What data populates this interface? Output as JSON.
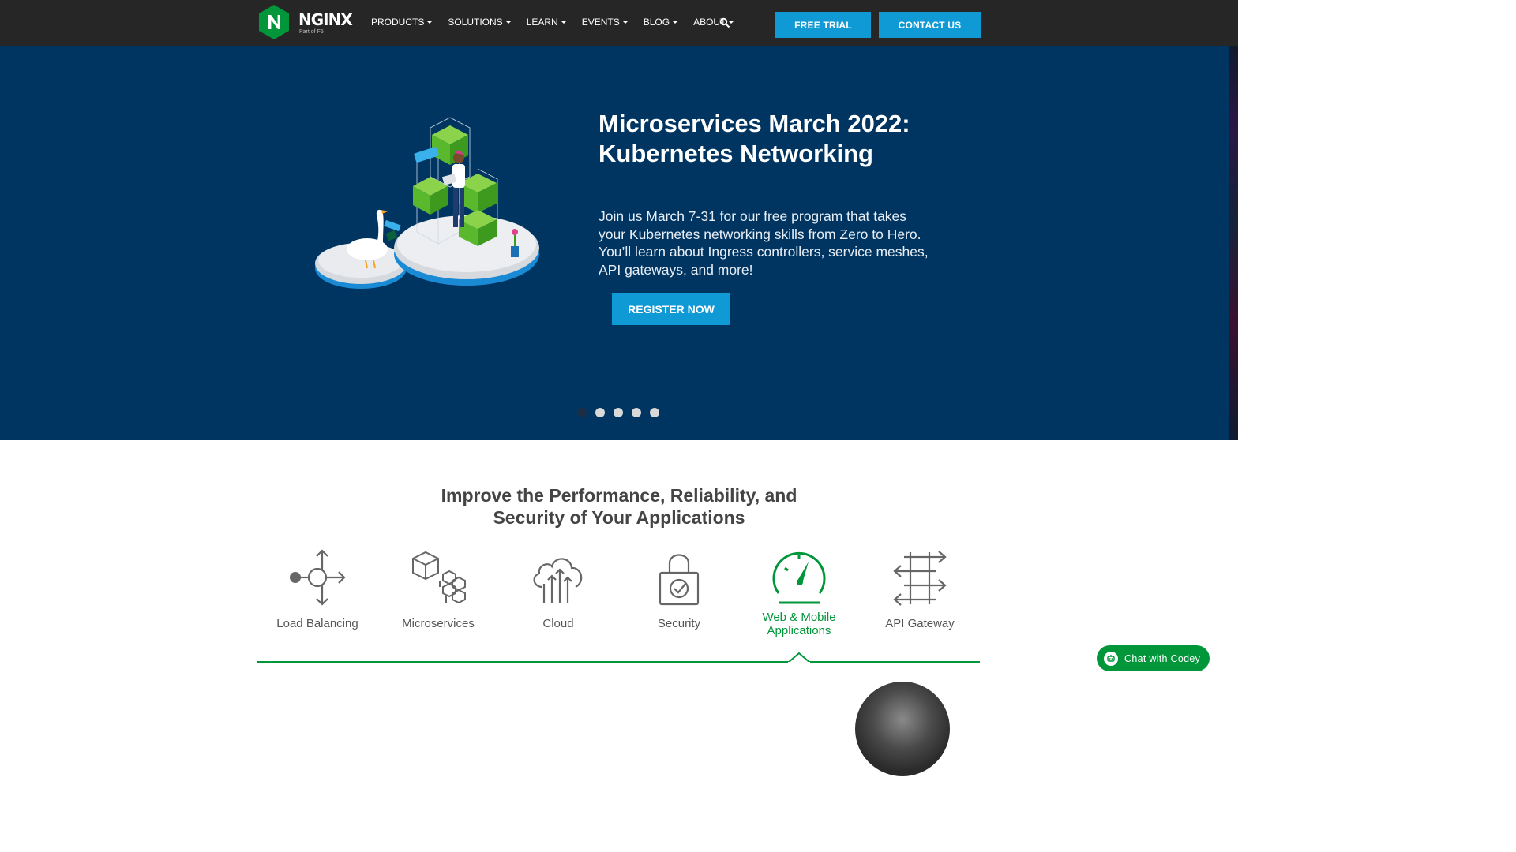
{
  "brand": {
    "name": "NGINX",
    "tagline": "Part of F5",
    "logo_letter": "N",
    "color_green": "#009639"
  },
  "nav": {
    "items": [
      {
        "label": "PRODUCTS",
        "has_dropdown": true
      },
      {
        "label": "SOLUTIONS",
        "has_dropdown": true
      },
      {
        "label": "LEARN",
        "has_dropdown": true
      },
      {
        "label": "EVENTS",
        "has_dropdown": true
      },
      {
        "label": "BLOG",
        "has_dropdown": true
      },
      {
        "label": "ABOUT",
        "has_dropdown": true
      }
    ],
    "search_icon": "search-icon",
    "free_trial": "FREE TRIAL",
    "contact_us": "CONTACT US"
  },
  "hero": {
    "title": "Microservices March 2022: Kubernetes Networking",
    "description": "Join us March 7-31 for our free program that takes your Kubernetes networking skills from Zero to Hero. You’ll learn about Ingress controllers, service meshes, API gateways, and more!",
    "cta": "REGISTER NOW",
    "background": "#003562",
    "slides_total": 5,
    "active_slide": 1
  },
  "improve": {
    "title": "Improve the Performance, Reliability, and Security of Your Applications",
    "features": [
      {
        "label": "Load Balancing",
        "icon": "load-balancing-icon",
        "active": false
      },
      {
        "label": "Microservices",
        "icon": "microservices-icon",
        "active": false
      },
      {
        "label": "Cloud",
        "icon": "cloud-icon",
        "active": false
      },
      {
        "label": "Security",
        "icon": "security-lock-icon",
        "active": false
      },
      {
        "label": "Web & Mobile Applications",
        "icon": "speedometer-icon",
        "active": true
      },
      {
        "label": "API Gateway",
        "icon": "api-gateway-icon",
        "active": false
      }
    ]
  },
  "chat": {
    "label": "Chat with Codey",
    "icon": "chat-bot-icon"
  },
  "colors": {
    "accent_blue": "#0f9ad6",
    "nav_bg": "#262626",
    "active_green": "#009639"
  }
}
